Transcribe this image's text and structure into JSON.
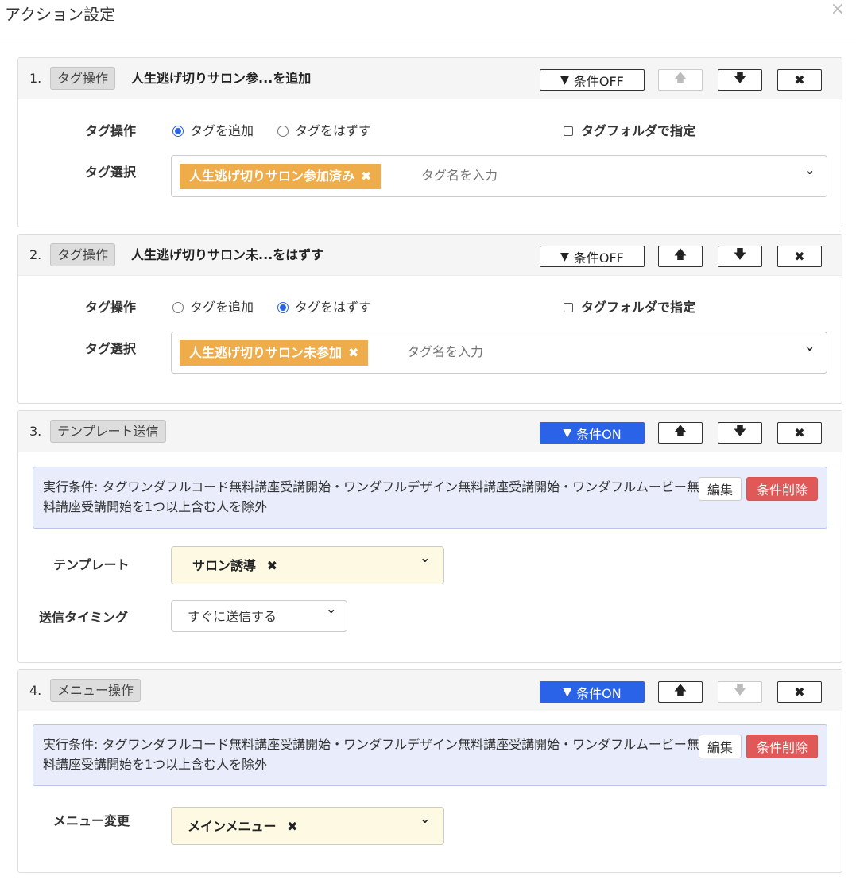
{
  "modal": {
    "title": "アクション設定",
    "close_icon": "×"
  },
  "icons": {
    "funnel": "▼",
    "arrow_up": "🡅",
    "arrow_down": "🡇",
    "delete": "✖",
    "chip_close": "✖",
    "chevron": "⌄"
  },
  "colors": {
    "accent": "#2a62e8",
    "chip": "#efac4a",
    "danger": "#e05858",
    "condition_bg": "#e8ecfb",
    "select_yellow": "#fdf9e3"
  },
  "actions": [
    {
      "number": "1.",
      "type_label": "タグ操作",
      "summary": "人生逃げ切りサロン参...を追加",
      "condition_button": "条件OFF",
      "condition_on": false,
      "up_enabled": false,
      "down_enabled": true,
      "tag_operation_label": "タグ操作",
      "radio_add": "タグを追加",
      "radio_remove": "タグをはずす",
      "selected": "add",
      "folder_checkbox": "タグフォルダで指定",
      "tag_select_label": "タグ選択",
      "chip": "人生逃げ切りサロン参加済み",
      "input_placeholder": "タグ名を入力"
    },
    {
      "number": "2.",
      "type_label": "タグ操作",
      "summary": "人生逃げ切りサロン未...をはずす",
      "condition_button": "条件OFF",
      "condition_on": false,
      "up_enabled": true,
      "down_enabled": true,
      "tag_operation_label": "タグ操作",
      "radio_add": "タグを追加",
      "radio_remove": "タグをはずす",
      "selected": "remove",
      "folder_checkbox": "タグフォルダで指定",
      "tag_select_label": "タグ選択",
      "chip": "人生逃げ切りサロン未参加",
      "input_placeholder": "タグ名を入力"
    },
    {
      "number": "3.",
      "type_label": "テンプレート送信",
      "condition_button": "条件ON",
      "condition_on": true,
      "up_enabled": true,
      "down_enabled": true,
      "condition_text": "実行条件: タグワンダフルコード無料講座受講開始・ワンダフルデザイン無料講座受講開始・ワンダフルムービー無料講座受講開始を1つ以上含む人を除外",
      "edit_button": "編集",
      "delete_condition_button": "条件削除",
      "template_label": "テンプレート",
      "template_value": "サロン誘導",
      "timing_label": "送信タイミング",
      "timing_value": "すぐに送信する"
    },
    {
      "number": "4.",
      "type_label": "メニュー操作",
      "condition_button": "条件ON",
      "condition_on": true,
      "up_enabled": true,
      "down_enabled": false,
      "condition_text": "実行条件: タグワンダフルコード無料講座受講開始・ワンダフルデザイン無料講座受講開始・ワンダフルムービー無料講座受講開始を1つ以上含む人を除外",
      "edit_button": "編集",
      "delete_condition_button": "条件削除",
      "menu_label": "メニュー変更",
      "menu_value": "メインメニュー"
    }
  ]
}
